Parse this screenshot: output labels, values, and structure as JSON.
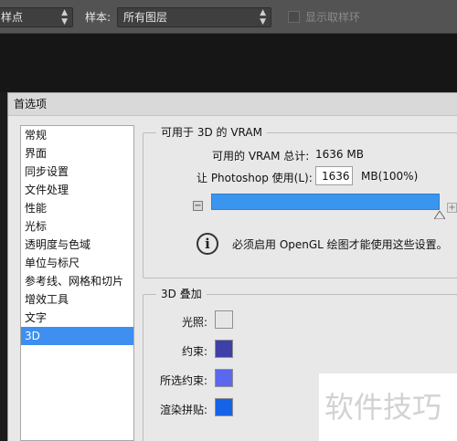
{
  "options_bar": {
    "sample_size_value": "样点",
    "sample_label": "样本:",
    "sample_value": "所有图层",
    "show_ring_label": "显示取样环"
  },
  "dialog": {
    "title": "首选项",
    "nav_items": [
      "常规",
      "界面",
      "同步设置",
      "文件处理",
      "性能",
      "光标",
      "透明度与色域",
      "单位与标尺",
      "参考线、网格和切片",
      "增效工具",
      "文字",
      "3D"
    ],
    "selected_nav": "3D",
    "vram": {
      "legend": "可用于 3D 的 VRAM",
      "total_label": "可用的 VRAM 总计:",
      "total_value": "1636 MB",
      "use_label": "让 Photoshop 使用(L):",
      "use_value": "1636",
      "use_unit": "MB(100%)",
      "slider_fraction": 1.0,
      "info_text": "必须启用 OpenGL 绘图才能使用这些设置。"
    },
    "overlay": {
      "legend": "3D 叠加",
      "items": [
        {
          "label": "光照:",
          "color": "#e6e6e6"
        },
        {
          "label": "约束:",
          "color": "#3f3fa8"
        },
        {
          "label": "所选约束:",
          "color": "#5b68ee"
        },
        {
          "label": "渲染拼贴:",
          "color": "#1663e8"
        }
      ]
    }
  },
  "watermark": "软件技巧"
}
